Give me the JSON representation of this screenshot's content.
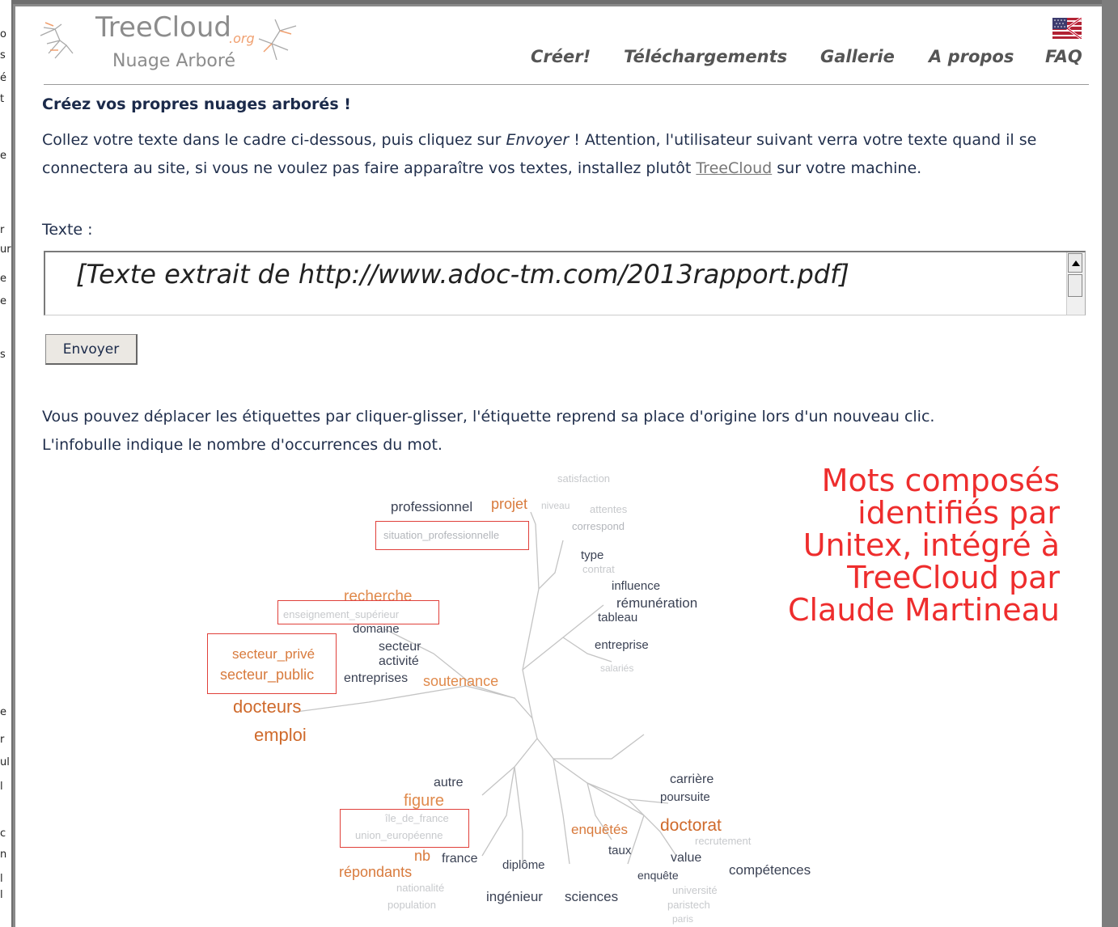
{
  "left_strip_chars": [
    "o",
    "s",
    "é",
    "t",
    "e",
    "r",
    "ur",
    "e",
    "e",
    "s",
    "e",
    "r",
    "ul",
    "l",
    "c",
    "n",
    "l",
    "l"
  ],
  "header": {
    "logo_title": "TreeCloud",
    "logo_org": ".org",
    "logo_subtitle": "Nuage Arboré",
    "nav": [
      "Créer!",
      "Téléchargements",
      "Gallerie",
      "A propos",
      "FAQ"
    ],
    "flag_icon": "uk-flag-icon"
  },
  "main": {
    "heading": "Créez vos propres nuages arborés !",
    "intro_before": "Collez votre texte dans le cadre ci-dessous, puis cliquez sur ",
    "intro_em": "Envoyer",
    "intro_middle": " ! Attention, l'utilisateur suivant verra votre texte quand il se connectera au site, si vous ne voulez pas faire apparaître vos textes, installez plutôt ",
    "intro_link": "TreeCloud",
    "intro_after": " sur votre machine.",
    "texte_label": "Texte :",
    "textarea_value": "[Texte extrait de http://www.adoc-tm.com/2013rapport.pdf]",
    "submit_label": "Envoyer",
    "info_line1": "Vous pouvez déplacer les étiquettes par cliquer-glisser, l'étiquette reprend sa place d'origine lors d'un nouveau clic.",
    "info_line2": "L'infobulle indique le nombre d'occurrences du mot."
  },
  "cloud_words": [
    {
      "text": "satisfaction",
      "color": "#c7c9cc"
    },
    {
      "text": "professionnel",
      "color": "#3b4254"
    },
    {
      "text": "projet",
      "color": "#d87a3c"
    },
    {
      "text": "niveau",
      "color": "#c7c9cc"
    },
    {
      "text": "attentes",
      "color": "#c7c9cc"
    },
    {
      "text": "correspond",
      "color": "#b3b6bb"
    },
    {
      "text": "situation_professionnelle",
      "color": "#b3b6bb"
    },
    {
      "text": "type",
      "color": "#3b4254"
    },
    {
      "text": "contrat",
      "color": "#c7c9cc"
    },
    {
      "text": "influence",
      "color": "#3b4254"
    },
    {
      "text": "rémunération",
      "color": "#3b4254"
    },
    {
      "text": "tableau",
      "color": "#3b4254"
    },
    {
      "text": "recherche",
      "color": "#e08a4c"
    },
    {
      "text": "enseignement_supérieur",
      "color": "#c7c9cc"
    },
    {
      "text": "domaine",
      "color": "#3b4254"
    },
    {
      "text": "secteur",
      "color": "#3b4254"
    },
    {
      "text": "entreprise",
      "color": "#3b4254"
    },
    {
      "text": "secteur_privé",
      "color": "#d87a3c"
    },
    {
      "text": "activité",
      "color": "#3b4254"
    },
    {
      "text": "salariés",
      "color": "#c7c9cc"
    },
    {
      "text": "secteur_public",
      "color": "#d87a3c"
    },
    {
      "text": "entreprises",
      "color": "#3b4254"
    },
    {
      "text": "soutenance",
      "color": "#e08a4c"
    },
    {
      "text": "docteurs",
      "color": "#cf6a2c"
    },
    {
      "text": "emploi",
      "color": "#cf6a2c"
    },
    {
      "text": "carrière",
      "color": "#3b4254"
    },
    {
      "text": "autre",
      "color": "#3b4254"
    },
    {
      "text": "poursuite",
      "color": "#3b4254"
    },
    {
      "text": "figure",
      "color": "#e08a4c"
    },
    {
      "text": "île_de_france",
      "color": "#c7c9cc"
    },
    {
      "text": "doctorat",
      "color": "#cf6a2c"
    },
    {
      "text": "enquêtés",
      "color": "#d87a3c"
    },
    {
      "text": "union_européenne",
      "color": "#c7c9cc"
    },
    {
      "text": "recrutement",
      "color": "#c7c9cc"
    },
    {
      "text": "taux",
      "color": "#3b4254"
    },
    {
      "text": "nb",
      "color": "#d87a3c"
    },
    {
      "text": "france",
      "color": "#3b4254"
    },
    {
      "text": "value",
      "color": "#3b4254"
    },
    {
      "text": "diplôme",
      "color": "#3b4254"
    },
    {
      "text": "compétences",
      "color": "#3b4254"
    },
    {
      "text": "répondants",
      "color": "#d87a3c"
    },
    {
      "text": "enquête",
      "color": "#3b4254"
    },
    {
      "text": "nationalité",
      "color": "#c7c9cc"
    },
    {
      "text": "université",
      "color": "#c7c9cc"
    },
    {
      "text": "ingénieur",
      "color": "#3b4254"
    },
    {
      "text": "sciences",
      "color": "#3b4254"
    },
    {
      "text": "population",
      "color": "#c7c9cc"
    },
    {
      "text": "paristech",
      "color": "#c7c9cc"
    },
    {
      "text": "paris",
      "color": "#c7c9cc"
    }
  ],
  "annotation": {
    "lines": [
      "Mots composés",
      "identifiés par",
      "Unitex, intégré à",
      "TreeCloud par",
      "Claude Martineau"
    ],
    "color": "#ee2d2d"
  }
}
